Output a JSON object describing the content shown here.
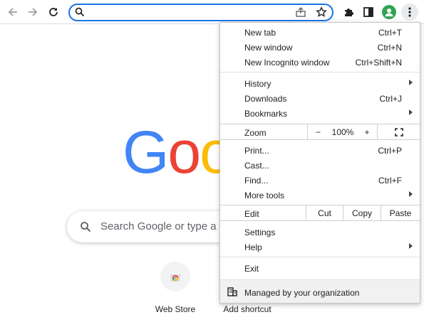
{
  "omnibox": {
    "value": ""
  },
  "ntp": {
    "logo_letters": [
      {
        "ch": "G",
        "color": "#4285F4"
      },
      {
        "ch": "o",
        "color": "#EA4335"
      },
      {
        "ch": "o",
        "color": "#FBBC05"
      }
    ],
    "search_placeholder": "Search Google or type a U",
    "shortcuts": [
      {
        "label": "Web Store"
      },
      {
        "label": "Add shortcut"
      }
    ]
  },
  "menu": {
    "group1": [
      {
        "label": "New tab",
        "shortcut": "Ctrl+T"
      },
      {
        "label": "New window",
        "shortcut": "Ctrl+N"
      },
      {
        "label": "New Incognito window",
        "shortcut": "Ctrl+Shift+N"
      }
    ],
    "group2": [
      {
        "label": "History",
        "shortcut": ""
      },
      {
        "label": "Downloads",
        "shortcut": "Ctrl+J"
      },
      {
        "label": "Bookmarks",
        "shortcut": ""
      }
    ],
    "zoom": {
      "label": "Zoom",
      "minus": "−",
      "value": "100%",
      "plus": "+"
    },
    "group3": [
      {
        "label": "Print...",
        "shortcut": "Ctrl+P"
      },
      {
        "label": "Cast...",
        "shortcut": ""
      },
      {
        "label": "Find...",
        "shortcut": "Ctrl+F"
      },
      {
        "label": "More tools",
        "shortcut": ""
      }
    ],
    "edit": {
      "label": "Edit",
      "cut": "Cut",
      "copy": "Copy",
      "paste": "Paste"
    },
    "group4": [
      {
        "label": "Settings"
      },
      {
        "label": "Help"
      }
    ],
    "exit": "Exit",
    "managed": "Managed by your organization"
  },
  "colors": {
    "accent": "#1a73e8",
    "avatar": "#31a354"
  }
}
